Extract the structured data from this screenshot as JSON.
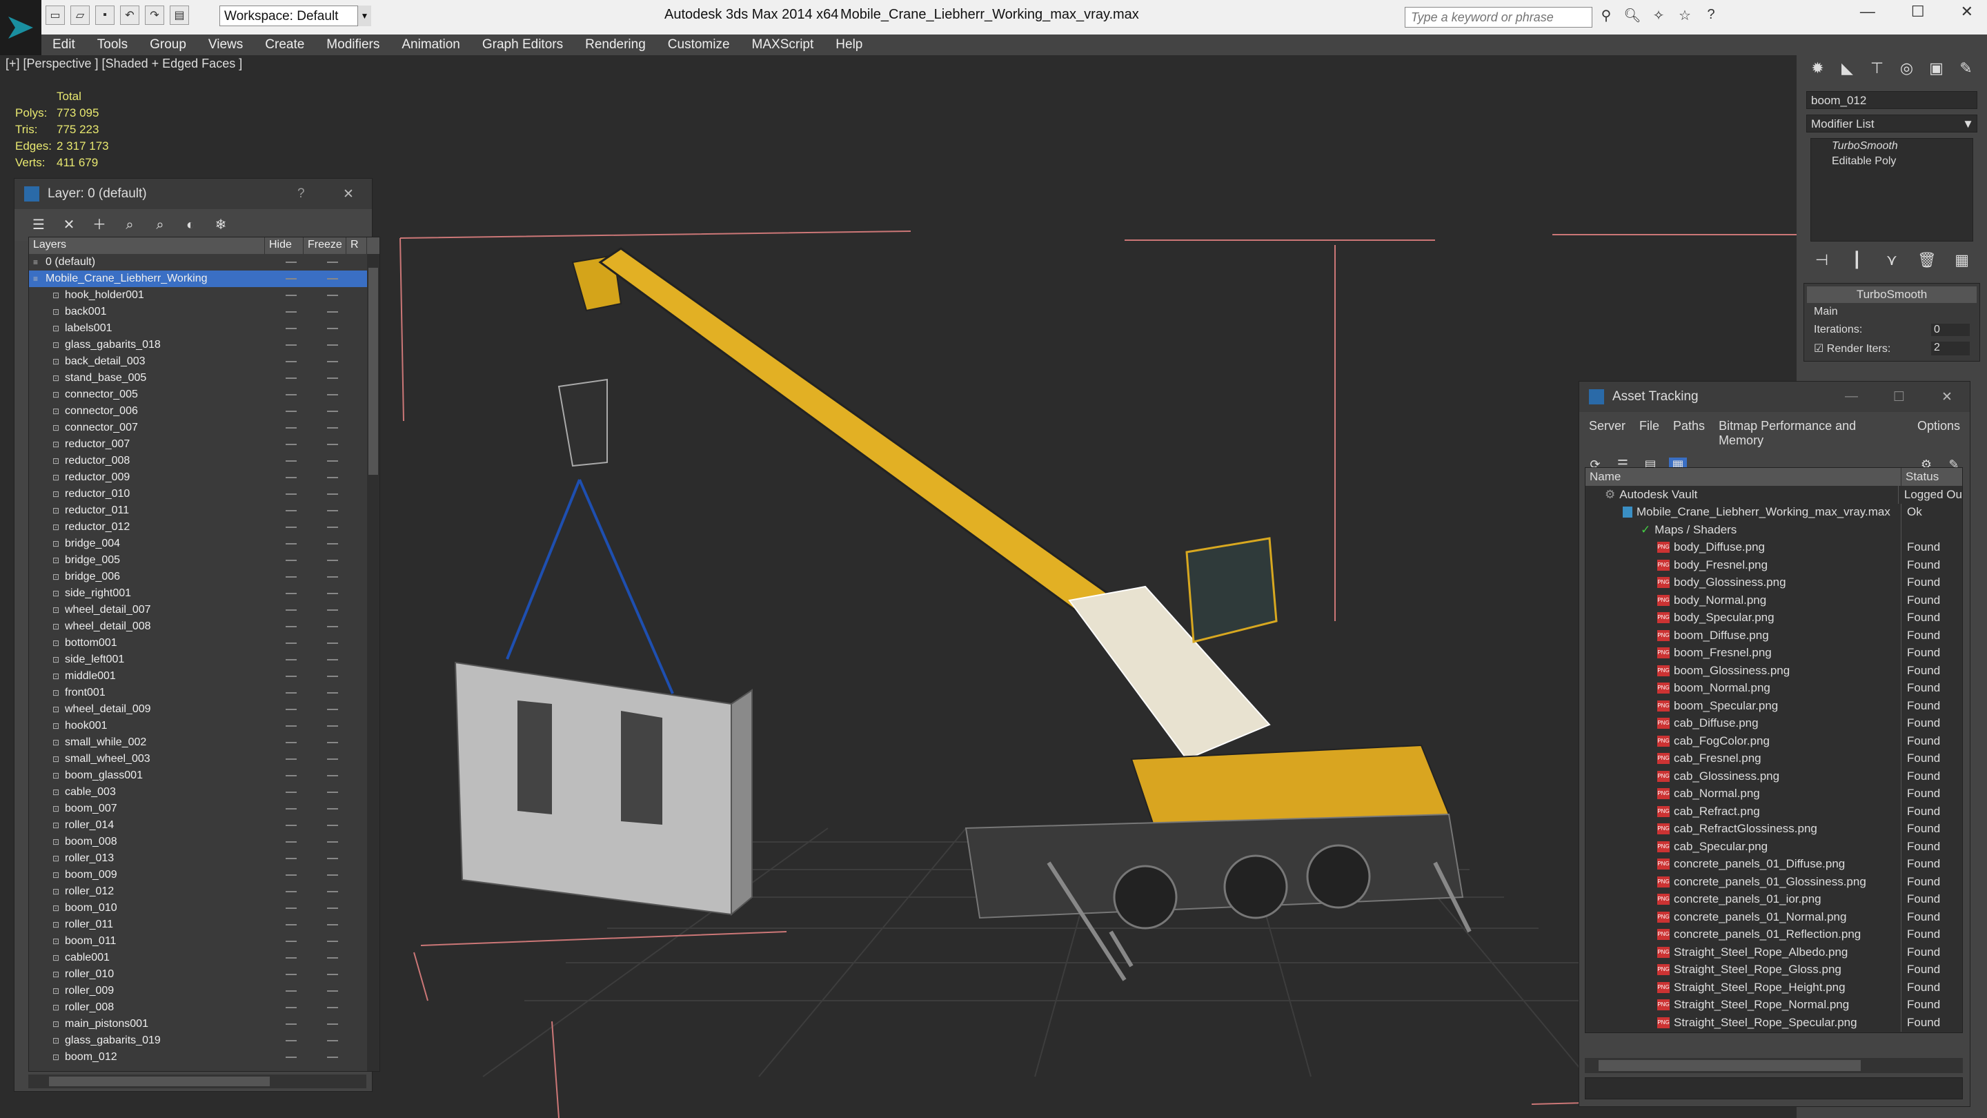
{
  "app": {
    "title": "Autodesk 3ds Max 2014 x64",
    "file": "Mobile_Crane_Liebherr_Working_max_vray.max",
    "workspace": "Workspace: Default",
    "search_placeholder": "Type a keyword or phrase"
  },
  "menu": [
    "Edit",
    "Tools",
    "Group",
    "Views",
    "Create",
    "Modifiers",
    "Animation",
    "Graph Editors",
    "Rendering",
    "Customize",
    "MAXScript",
    "Help"
  ],
  "viewport": {
    "label": "[+] [Perspective ] [Shaded + Edged Faces ]",
    "stats": {
      "header": "Total",
      "rows": [
        {
          "label": "Polys:",
          "value": "773 095"
        },
        {
          "label": "Tris:",
          "value": "775 223"
        },
        {
          "label": "Edges:",
          "value": "2 317 173"
        },
        {
          "label": "Verts:",
          "value": "411 679"
        }
      ]
    }
  },
  "layer_panel": {
    "title": "Layer: 0 (default)",
    "col_layers": "Layers",
    "col_hide": "Hide",
    "col_freeze": "Freeze",
    "col_extra": "R",
    "rows": [
      "0 (default)",
      "Mobile_Crane_Liebherr_Working",
      "hook_holder001",
      "back001",
      "labels001",
      "glass_gabarits_018",
      "back_detail_003",
      "stand_base_005",
      "connector_005",
      "connector_006",
      "connector_007",
      "reductor_007",
      "reductor_008",
      "reductor_009",
      "reductor_010",
      "reductor_011",
      "reductor_012",
      "bridge_004",
      "bridge_005",
      "bridge_006",
      "side_right001",
      "wheel_detail_007",
      "wheel_detail_008",
      "bottom001",
      "side_left001",
      "middle001",
      "front001",
      "wheel_detail_009",
      "hook001",
      "small_while_002",
      "small_wheel_003",
      "boom_glass001",
      "cable_003",
      "boom_007",
      "roller_014",
      "boom_008",
      "roller_013",
      "boom_009",
      "roller_012",
      "boom_010",
      "roller_011",
      "boom_011",
      "cable001",
      "roller_010",
      "roller_009",
      "roller_008",
      "main_pistons001",
      "glass_gabarits_019",
      "boom_012"
    ]
  },
  "command_panel": {
    "object_name": "boom_012",
    "modifier_list": "Modifier List",
    "stack": [
      "TurboSmooth",
      "Editable Poly"
    ],
    "rollout_title": "TurboSmooth",
    "main_label": "Main",
    "iterations_label": "Iterations:",
    "iterations_value": "0",
    "render_iters_label": "Render Iters:",
    "render_iters_value": "2"
  },
  "asset_tracking": {
    "title": "Asset Tracking",
    "menu": [
      "Server",
      "File",
      "Paths",
      "Bitmap Performance and Memory",
      "Options"
    ],
    "col_name": "Name",
    "col_status": "Status",
    "vault": {
      "name": "Autodesk Vault",
      "status": "Logged Ou"
    },
    "file": {
      "name": "Mobile_Crane_Liebherr_Working_max_vray.max",
      "status": "Ok"
    },
    "group": "Maps / Shaders",
    "maps": [
      "body_Diffuse.png",
      "body_Fresnel.png",
      "body_Glossiness.png",
      "body_Normal.png",
      "body_Specular.png",
      "boom_Diffuse.png",
      "boom_Fresnel.png",
      "boom_Glossiness.png",
      "boom_Normal.png",
      "boom_Specular.png",
      "cab_Diffuse.png",
      "cab_FogColor.png",
      "cab_Fresnel.png",
      "cab_Glossiness.png",
      "cab_Normal.png",
      "cab_Refract.png",
      "cab_RefractGlossiness.png",
      "cab_Specular.png",
      "concrete_panels_01_Diffuse.png",
      "concrete_panels_01_Glossiness.png",
      "concrete_panels_01_ior.png",
      "concrete_panels_01_Normal.png",
      "concrete_panels_01_Reflection.png",
      "Straight_Steel_Rope_Albedo.png",
      "Straight_Steel_Rope_Gloss.png",
      "Straight_Steel_Rope_Height.png",
      "Straight_Steel_Rope_Normal.png",
      "Straight_Steel_Rope_Specular.png"
    ],
    "found": "Found"
  }
}
